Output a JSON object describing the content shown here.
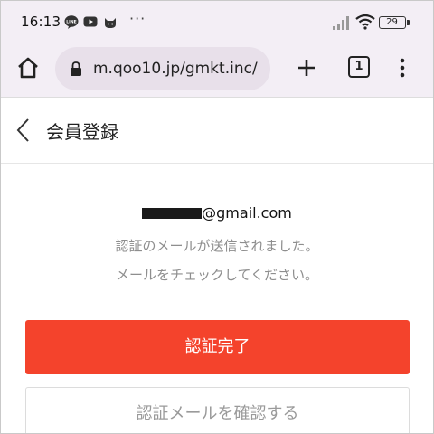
{
  "status_bar": {
    "time": "16:13",
    "overflow": "···",
    "battery_level": "29",
    "icons": [
      "line-icon",
      "youtube-icon",
      "cat-app-icon",
      "signal-icon",
      "wifi-icon",
      "battery-icon"
    ]
  },
  "browser": {
    "url": "m.qoo10.jp/gmkt.inc/",
    "tab_count": "1",
    "icons": [
      "home-icon",
      "lock-icon",
      "plus-icon",
      "tabs-icon",
      "more-vertical-icon"
    ]
  },
  "header": {
    "title": "会員登録",
    "back_icon": "chevron-left-icon"
  },
  "content": {
    "email_suffix": "@gmail.com",
    "message_line1": "認証のメールが送信されました。",
    "message_line2": "メールをチェックしてください。"
  },
  "buttons": {
    "primary_label": "認証完了",
    "secondary_label": "認証メールを確認する"
  },
  "colors": {
    "primary": "#f4432c",
    "browser_bg": "#f3eef5",
    "url_bg": "#e8e0ea"
  }
}
